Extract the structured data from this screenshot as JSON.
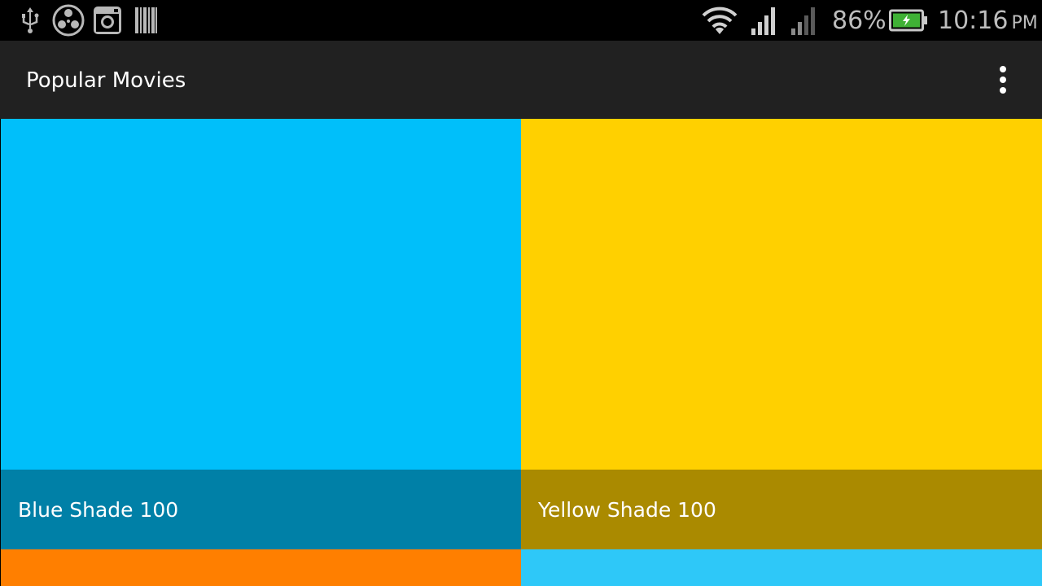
{
  "status_bar": {
    "battery_percent": "86%",
    "time": "10:16",
    "ampm": "PM",
    "icons": [
      "usb-icon",
      "media-app-icon",
      "instagram-icon",
      "barcode-icon",
      "wifi-icon",
      "signal-icon",
      "signal-secondary-icon",
      "battery-charging-icon"
    ]
  },
  "action_bar": {
    "title": "Popular Movies",
    "overflow_icon": "more-vert-icon"
  },
  "grid": {
    "tiles": [
      {
        "color": "#00bffa",
        "caption_color": "#0080a7",
        "label": "Blue Shade 100"
      },
      {
        "color": "#ffd000",
        "caption_color": "#aa8a00",
        "label": "Yellow Shade 100"
      },
      {
        "color": "#ff7f00",
        "caption_color": "",
        "label": ""
      },
      {
        "color": "#2ec8f8",
        "caption_color": "",
        "label": ""
      }
    ]
  }
}
